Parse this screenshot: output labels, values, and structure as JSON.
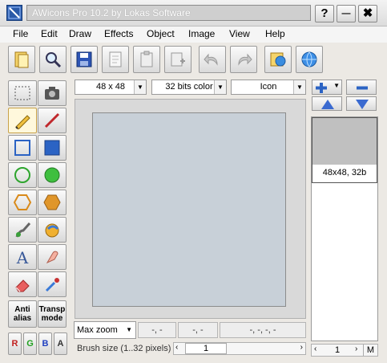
{
  "window": {
    "title": "AWicons Pro 10.2 by Lokas Software"
  },
  "window_buttons": {
    "help": "?",
    "minimize": "—",
    "close": "✖"
  },
  "menu": [
    "File",
    "Edit",
    "Draw",
    "Effects",
    "Object",
    "Image",
    "View",
    "Help"
  ],
  "toolbar_icons": [
    "open-icon",
    "zoom-icon",
    "save-icon",
    "new-page-icon",
    "paste-icon",
    "paste-new-icon",
    "undo-icon",
    "redo-icon",
    "library-icon",
    "globe-icon"
  ],
  "left_tools": [
    "select-tool",
    "camera-tool",
    "pencil-tool",
    "line-tool",
    "rect-outline-tool",
    "rect-fill-tool",
    "ellipse-outline-tool",
    "ellipse-fill-tool",
    "hexagon-outline-tool",
    "hexagon-fill-tool",
    "brush-tool",
    "fill-tool",
    "text-tool",
    "smudge-tool",
    "eraser-tool",
    "eyedropper-tool"
  ],
  "options": {
    "antialias": "Anti alias",
    "transp_mode": "Transp mode"
  },
  "channels": [
    "R",
    "G",
    "B",
    "A"
  ],
  "image_controls": {
    "size": "48 x 48",
    "color_depth": "32 bits color",
    "format": "Icon"
  },
  "canvas": {
    "background_color": "#c8d0d8"
  },
  "status": {
    "zoom": "Max zoom",
    "coord1": "-, -",
    "coord2": "-, -",
    "coord3": "-, -, -, -",
    "brush_label": "Brush size (1..32 pixels)",
    "brush_value": "1"
  },
  "right_panel": {
    "thumbnail_label": "48x48, 32b",
    "page_value": "1",
    "m_button": "M"
  }
}
